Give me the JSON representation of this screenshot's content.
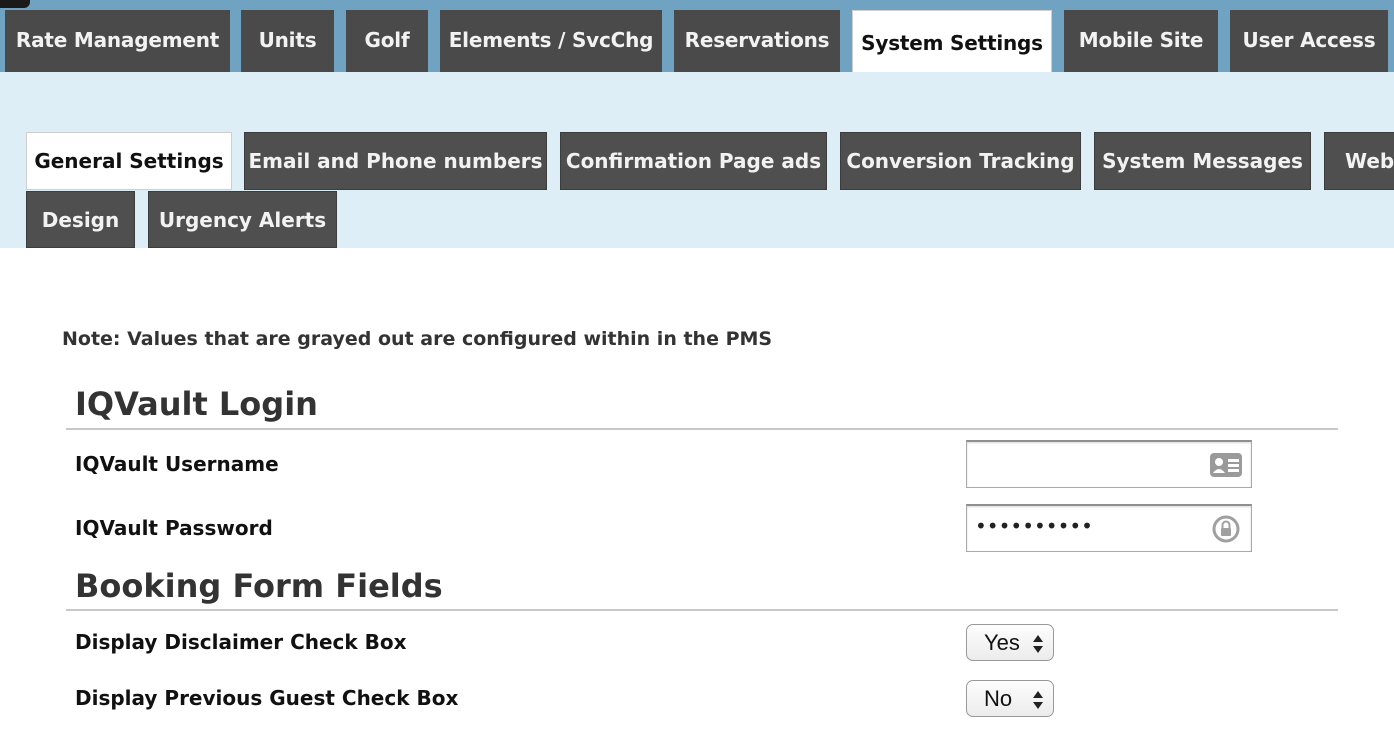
{
  "top_nav": {
    "tabs": [
      {
        "label": "Rate Management",
        "active": false
      },
      {
        "label": "Units",
        "active": false
      },
      {
        "label": "Golf",
        "active": false
      },
      {
        "label": "Elements / SvcChg",
        "active": false
      },
      {
        "label": "Reservations",
        "active": false
      },
      {
        "label": "System Settings",
        "active": true
      },
      {
        "label": "Mobile Site",
        "active": false
      },
      {
        "label": "User Access",
        "active": false
      }
    ]
  },
  "sub_nav": {
    "tabs": [
      {
        "label": "General Settings",
        "active": true
      },
      {
        "label": "Email and Phone numbers",
        "active": false
      },
      {
        "label": "Confirmation Page ads",
        "active": false
      },
      {
        "label": "Conversion Tracking",
        "active": false
      },
      {
        "label": "System Messages",
        "active": false
      },
      {
        "label": "Webs",
        "active": false
      },
      {
        "label": "Design",
        "active": false
      },
      {
        "label": "Urgency Alerts",
        "active": false
      }
    ]
  },
  "note": "Note: Values that are grayed out are configured within in the PMS",
  "sections": {
    "iqvault": {
      "title": "IQVault Login",
      "username_label": "IQVault Username",
      "username_value": "",
      "username_icon": "contact-card-icon",
      "password_label": "IQVault Password",
      "password_value": "••••••••••",
      "password_icon": "lock-icon"
    },
    "booking": {
      "title": "Booking Form Fields",
      "disclaimer_label": "Display Disclaimer Check Box",
      "disclaimer_value": "Yes",
      "previous_guest_label": "Display Previous Guest Check Box",
      "previous_guest_value": "No"
    }
  },
  "colors": {
    "top_bar": "#6fa3c1",
    "tab_dark": "#4a4a4a",
    "subnav_bg": "#deeef6"
  }
}
